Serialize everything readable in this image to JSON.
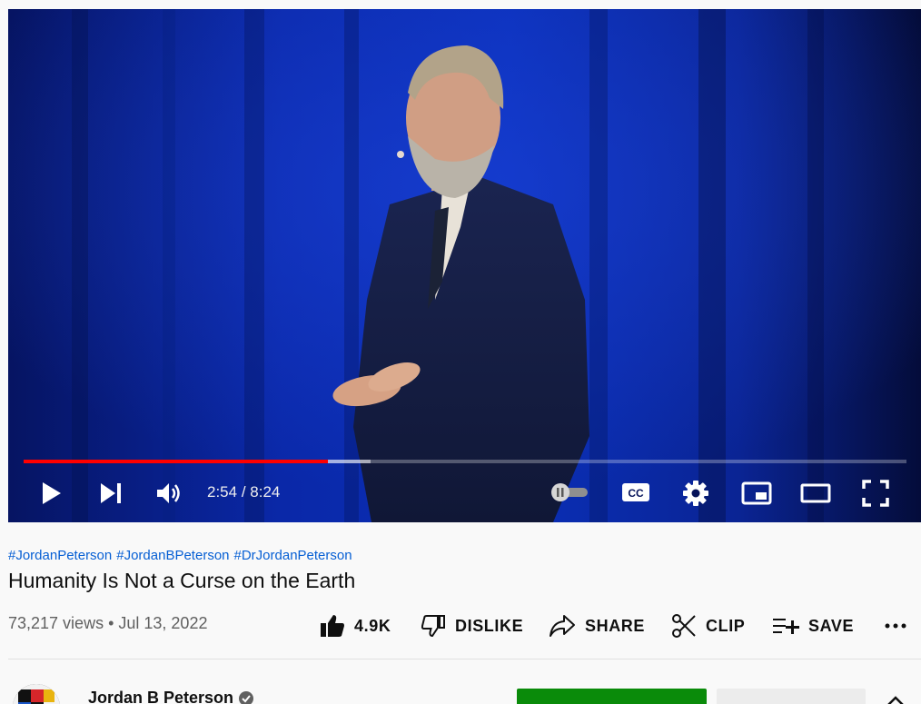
{
  "player": {
    "time_current": "2:54",
    "time_separator": " / ",
    "time_total": "8:24",
    "progress_fraction": 0.345,
    "buffered_fraction": 0.393,
    "autoplay_on": false
  },
  "video": {
    "hashtags": [
      "#JordanPeterson",
      "#JordanBPeterson",
      "#DrJordanPeterson"
    ],
    "title": "Humanity Is Not a Curse on the Earth",
    "views": "73,217 views",
    "meta_separator": " • ",
    "date": "Jul 13, 2022"
  },
  "actions": {
    "like_count": "4.9K",
    "dislike_label": "DISLIKE",
    "share_label": "SHARE",
    "clip_label": "CLIP",
    "save_label": "SAVE"
  },
  "channel": {
    "name": "Jordan B Peterson"
  },
  "colors": {
    "progress": "#ff0000",
    "link": "#065fd4",
    "join_button": "#0a8b0a"
  }
}
